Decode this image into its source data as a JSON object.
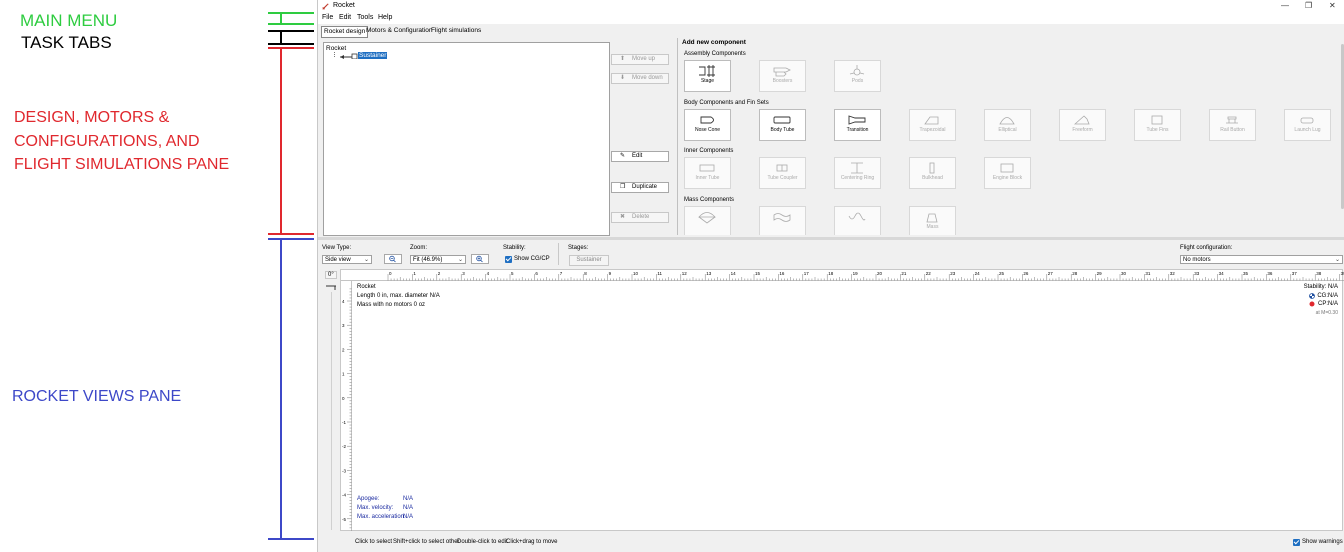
{
  "annotations": {
    "main_menu": "MAIN MENU",
    "task_tabs": "TASK  TABS",
    "design_pane_lines": [
      "DESIGN, MOTORS &",
      "CONFIGURATIONS, AND",
      "FLIGHT SIMULATIONS PANE"
    ],
    "rocket_views_pane": "ROCKET VIEWS PANE",
    "colors": {
      "green": "#2ecc40",
      "black": "#000000",
      "red": "#e0282e",
      "blue": "#3d48c8"
    }
  },
  "window": {
    "title": "Rocket",
    "app_icon": "rocket-icon"
  },
  "menu": [
    "File",
    "Edit",
    "Tools",
    "Help"
  ],
  "tabs": [
    "Rocket design",
    "Motors & Configuration",
    "Flight simulations"
  ],
  "tree": {
    "root": "Rocket",
    "child": "Sustainer"
  },
  "side_buttons": {
    "move_up": "Move up",
    "move_down": "Move down",
    "edit": "Edit",
    "duplicate": "Duplicate",
    "delete": "Delete"
  },
  "components_panel": {
    "title": "Add new component",
    "sections": [
      {
        "name": "Assembly Components",
        "items": [
          {
            "label": "Stage",
            "icon": "stage-icon",
            "enabled": true
          },
          {
            "label": "Boosters",
            "icon": "boosters-icon",
            "enabled": false
          },
          {
            "label": "Pods",
            "icon": "pods-icon",
            "enabled": false
          }
        ]
      },
      {
        "name": "Body Components and Fin Sets",
        "items": [
          {
            "label": "Nose Cone",
            "icon": "nose-cone-icon",
            "enabled": true
          },
          {
            "label": "Body Tube",
            "icon": "body-tube-icon",
            "enabled": true
          },
          {
            "label": "Transition",
            "icon": "transition-icon",
            "enabled": true
          },
          {
            "label": "Trapezoidal",
            "icon": "trapezoidal-fin-icon",
            "enabled": false
          },
          {
            "label": "Elliptical",
            "icon": "elliptical-fin-icon",
            "enabled": false
          },
          {
            "label": "Freeform",
            "icon": "freeform-fin-icon",
            "enabled": false
          },
          {
            "label": "Tube Fins",
            "icon": "tube-fins-icon",
            "enabled": false
          },
          {
            "label": "Rail Button",
            "icon": "rail-button-icon",
            "enabled": false
          },
          {
            "label": "Launch Lug",
            "icon": "launch-lug-icon",
            "enabled": false
          }
        ]
      },
      {
        "name": "Inner Components",
        "items": [
          {
            "label": "Inner Tube",
            "icon": "inner-tube-icon",
            "enabled": false
          },
          {
            "label": "Tube Coupler",
            "icon": "tube-coupler-icon",
            "enabled": false
          },
          {
            "label": "Centering Ring",
            "icon": "centering-ring-icon",
            "enabled": false
          },
          {
            "label": "Bulkhead",
            "icon": "bulkhead-icon",
            "enabled": false
          },
          {
            "label": "Engine Block",
            "icon": "engine-block-icon",
            "enabled": false
          }
        ]
      },
      {
        "name": "Mass Components",
        "items": [
          {
            "label": "",
            "icon": "parachute-icon",
            "enabled": false
          },
          {
            "label": "",
            "icon": "streamer-icon",
            "enabled": false
          },
          {
            "label": "",
            "icon": "shock-cord-icon",
            "enabled": false
          },
          {
            "label": "Mass",
            "icon": "mass-component-icon",
            "enabled": false
          }
        ]
      }
    ]
  },
  "views": {
    "view_type_label": "View Type:",
    "view_type_value": "Side view",
    "zoom_label": "Zoom:",
    "zoom_value": "Fit (46.9%)",
    "stability_label": "Stability:",
    "show_cgcp": "Show CG/CP",
    "stages_label": "Stages:",
    "stage_button": "Sustainer",
    "flight_config_label": "Flight configuration:",
    "flight_config_value": "No motors",
    "rotation": "0°",
    "ruler_x": [
      "0",
      "1",
      "2",
      "3",
      "4",
      "5",
      "6",
      "7",
      "8",
      "9",
      "10",
      "11",
      "12",
      "13",
      "14",
      "15",
      "16",
      "17",
      "18",
      "19",
      "20",
      "21",
      "22",
      "23",
      "24",
      "25",
      "26",
      "27",
      "28",
      "29",
      "30",
      "31",
      "32",
      "33",
      "34",
      "35",
      "36",
      "37",
      "38",
      "39"
    ],
    "ruler_y": [
      "4",
      "3",
      "2",
      "1",
      "0",
      "-1",
      "-2",
      "-3",
      "-4",
      "-5"
    ],
    "info": {
      "name": "Rocket",
      "length": "Length 0 in, max. diameter N/A",
      "mass": "Mass with no motors 0 oz",
      "stability": "Stability: N/A",
      "cg": "CG:N/A",
      "cp": "CP:N/A",
      "mach": "at M=0.30"
    },
    "flight_info": [
      {
        "label": "Apogee:",
        "value": "N/A"
      },
      {
        "label": "Max. velocity:",
        "value": "N/A"
      },
      {
        "label": "Max. acceleration:",
        "value": "N/A"
      }
    ]
  },
  "statusbar": {
    "hints": [
      "Click to select",
      "Shift+click to select other",
      "Double-click to edit",
      "Click+drag to move"
    ],
    "show_warnings": "Show warnings"
  }
}
